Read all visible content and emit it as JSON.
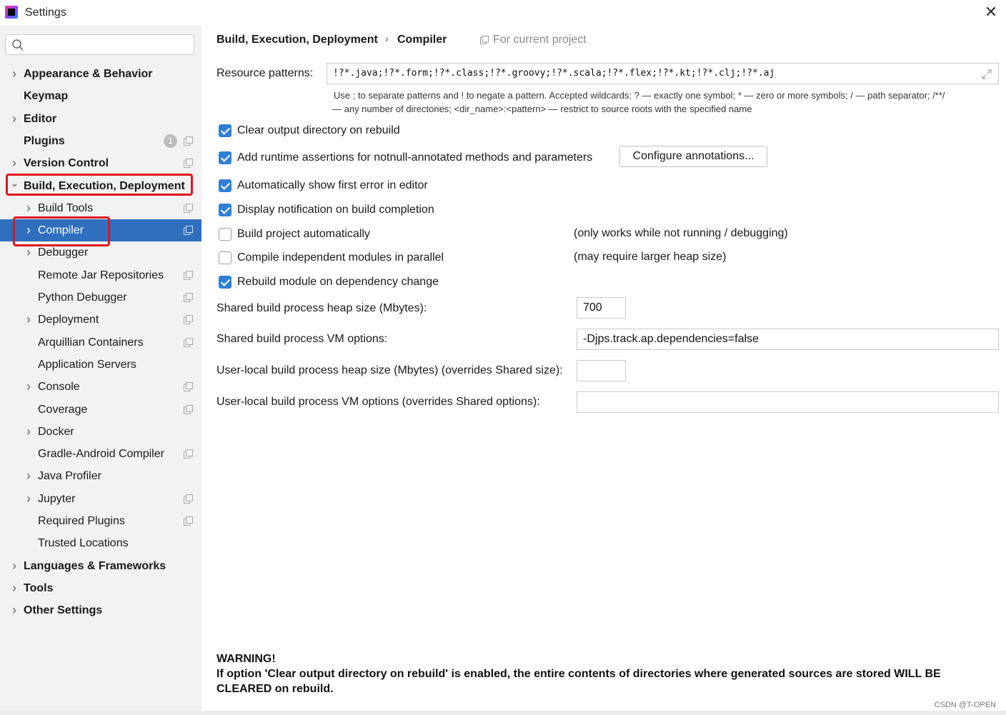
{
  "window": {
    "title": "Settings",
    "close_glyph": "✕"
  },
  "search": {
    "placeholder": "",
    "value": ""
  },
  "sidebar": {
    "items": [
      {
        "label": "Appearance & Behavior",
        "level": 0,
        "expandable": true,
        "bold": true
      },
      {
        "label": "Keymap",
        "level": 0,
        "expandable": false,
        "bold": true
      },
      {
        "label": "Editor",
        "level": 0,
        "expandable": true,
        "bold": true
      },
      {
        "label": "Plugins",
        "level": 0,
        "expandable": false,
        "bold": true,
        "badge": "1",
        "project_icon": true
      },
      {
        "label": "Version Control",
        "level": 0,
        "expandable": true,
        "bold": true,
        "project_icon": true
      },
      {
        "label": "Build, Execution, Deployment",
        "level": 0,
        "expandable": true,
        "expanded": true,
        "bold": true
      },
      {
        "label": "Build Tools",
        "level": 1,
        "expandable": true,
        "project_icon": true
      },
      {
        "label": "Compiler",
        "level": 1,
        "expandable": true,
        "selected": true,
        "project_icon": true
      },
      {
        "label": "Debugger",
        "level": 1,
        "expandable": true
      },
      {
        "label": "Remote Jar Repositories",
        "level": 1,
        "expandable": false,
        "project_icon": true
      },
      {
        "label": "Python Debugger",
        "level": 1,
        "expandable": false,
        "project_icon": true
      },
      {
        "label": "Deployment",
        "level": 1,
        "expandable": true,
        "project_icon": true
      },
      {
        "label": "Arquillian Containers",
        "level": 1,
        "expandable": false,
        "project_icon": true
      },
      {
        "label": "Application Servers",
        "level": 1,
        "expandable": false
      },
      {
        "label": "Console",
        "level": 1,
        "expandable": true,
        "project_icon": true
      },
      {
        "label": "Coverage",
        "level": 1,
        "expandable": false,
        "project_icon": true
      },
      {
        "label": "Docker",
        "level": 1,
        "expandable": true
      },
      {
        "label": "Gradle-Android Compiler",
        "level": 1,
        "expandable": false,
        "project_icon": true
      },
      {
        "label": "Java Profiler",
        "level": 1,
        "expandable": true
      },
      {
        "label": "Jupyter",
        "level": 1,
        "expandable": true,
        "project_icon": true
      },
      {
        "label": "Required Plugins",
        "level": 1,
        "expandable": false,
        "project_icon": true
      },
      {
        "label": "Trusted Locations",
        "level": 1,
        "expandable": false
      },
      {
        "label": "Languages & Frameworks",
        "level": 0,
        "expandable": true,
        "bold": true
      },
      {
        "label": "Tools",
        "level": 0,
        "expandable": true,
        "bold": true
      },
      {
        "label": "Other Settings",
        "level": 0,
        "expandable": true,
        "bold": true
      }
    ]
  },
  "breadcrumb": {
    "parent": "Build, Execution, Deployment",
    "separator": "›",
    "current": "Compiler",
    "scope": "For current project"
  },
  "resource_patterns": {
    "label": "Resource patterns:",
    "value": "!?*.java;!?*.form;!?*.class;!?*.groovy;!?*.scala;!?*.flex;!?*.kt;!?*.clj;!?*.aj",
    "hint_line1": "Use ; to separate patterns and ! to negate a pattern. Accepted wildcards: ? — exactly one symbol; * — zero or more symbols; / — path separator; /**/",
    "hint_line2": "— any number of directories; <dir_name>:<pattern> — restrict to source roots with the specified name"
  },
  "options": [
    {
      "label": "Clear output directory on rebuild",
      "checked": true
    },
    {
      "label": "Add runtime assertions for notnull-annotated methods and parameters",
      "checked": true
    },
    {
      "label": "Automatically show first error in editor",
      "checked": true
    },
    {
      "label": "Display notification on build completion",
      "checked": true
    },
    {
      "label": "Build project automatically",
      "checked": false,
      "note": "(only works while not running / debugging)"
    },
    {
      "label": "Compile independent modules in parallel",
      "checked": false,
      "note": "(may require larger heap size)"
    },
    {
      "label": "Rebuild module on dependency change",
      "checked": true
    }
  ],
  "configure_button": "Configure annotations...",
  "fields": {
    "shared_heap_label": "Shared build process heap size (Mbytes):",
    "shared_heap_value": "700",
    "shared_vm_label": "Shared build process VM options:",
    "shared_vm_value": "-Djps.track.ap.dependencies=false",
    "user_heap_label": "User-local build process heap size (Mbytes) (overrides Shared size):",
    "user_heap_value": "",
    "user_vm_label": "User-local build process VM options (overrides Shared options):",
    "user_vm_value": ""
  },
  "warning": {
    "title": "WARNING!",
    "text": "If option 'Clear output directory on rebuild' is enabled, the entire contents of directories where generated sources are stored WILL BE CLEARED on rebuild."
  },
  "watermark": "CSDN @T-OPEN",
  "colors": {
    "selection": "#2f6fbe",
    "checkbox": "#2f7fd6",
    "highlight_box": "#e0141e",
    "sidebar_bg": "#f2f2f2"
  }
}
